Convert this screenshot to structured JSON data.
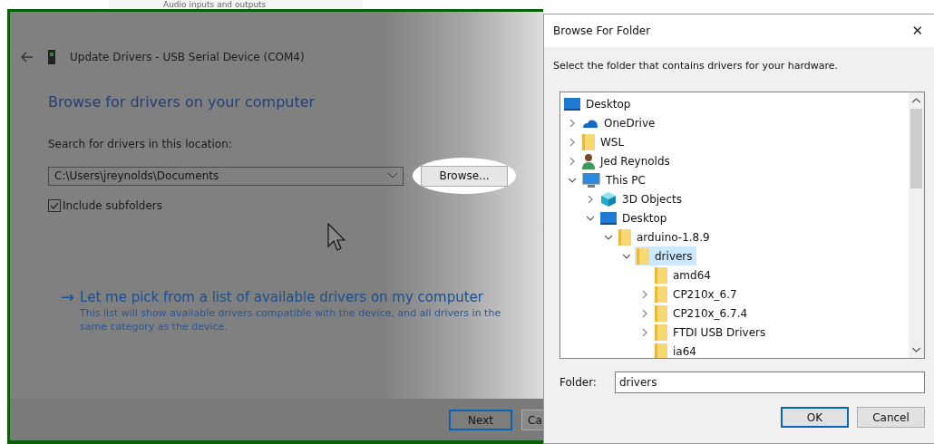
{
  "background_window": {
    "item": "Audio inputs and outputs"
  },
  "update_drivers": {
    "title": "Update Drivers - USB Serial Device (COM4)",
    "heading": "Browse for drivers on your computer",
    "location_label": "Search for drivers in this location:",
    "location_value": "C:\\Users\\jreynolds\\Documents",
    "browse_button": "Browse...",
    "include_subfolders": {
      "label": "Include subfolders",
      "checked": true
    },
    "pick_link": {
      "arrow": "→",
      "title": "Let me pick from a list of available drivers on my computer",
      "description": "This list will show available drivers compatible with the device, and all drivers in the same category as the device."
    },
    "buttons": [
      {
        "label": "Next",
        "default": true
      },
      {
        "label": "Ca",
        "default": false
      }
    ]
  },
  "browse_dialog": {
    "title": "Browse For Folder",
    "close": "✕",
    "instruction": "Select the folder that contains drivers for your hardware.",
    "tree": [
      {
        "label": "Desktop",
        "kind": "desktop",
        "selected": false,
        "children": [
          {
            "label": "OneDrive",
            "kind": "cloud",
            "expandable": true,
            "expanded": false,
            "selected": false
          },
          {
            "label": "WSL",
            "kind": "folder",
            "expandable": true,
            "expanded": false,
            "selected": false
          },
          {
            "label": "Jed Reynolds",
            "kind": "user",
            "expandable": true,
            "expanded": false,
            "selected": false
          },
          {
            "label": "This PC",
            "kind": "pc",
            "expandable": true,
            "expanded": true,
            "selected": false,
            "children": [
              {
                "label": "3D Objects",
                "kind": "cube",
                "expandable": true,
                "expanded": false,
                "selected": false
              },
              {
                "label": "Desktop",
                "kind": "desktop",
                "expandable": true,
                "expanded": true,
                "selected": false,
                "children": [
                  {
                    "label": "arduino-1.8.9",
                    "kind": "folder",
                    "expandable": true,
                    "expanded": true,
                    "selected": false,
                    "children": [
                      {
                        "label": "drivers",
                        "kind": "folder",
                        "expandable": true,
                        "expanded": true,
                        "selected": true,
                        "children": [
                          {
                            "label": "amd64",
                            "kind": "folder",
                            "expandable": false,
                            "selected": false
                          },
                          {
                            "label": "CP210x_6.7",
                            "kind": "folder",
                            "expandable": true,
                            "expanded": false,
                            "selected": false
                          },
                          {
                            "label": "CP210x_6.7.4",
                            "kind": "folder",
                            "expandable": true,
                            "expanded": false,
                            "selected": false
                          },
                          {
                            "label": "FTDI USB Drivers",
                            "kind": "folder",
                            "expandable": true,
                            "expanded": false,
                            "selected": false
                          },
                          {
                            "label": "ia64",
                            "kind": "folder",
                            "expandable": false,
                            "selected": false
                          }
                        ]
                      }
                    ]
                  }
                ]
              }
            ]
          }
        ]
      }
    ],
    "folder_label": "Folder:",
    "folder_value": "drivers",
    "buttons": [
      {
        "label": "OK",
        "default": true
      },
      {
        "label": "Cancel",
        "default": false
      }
    ]
  }
}
